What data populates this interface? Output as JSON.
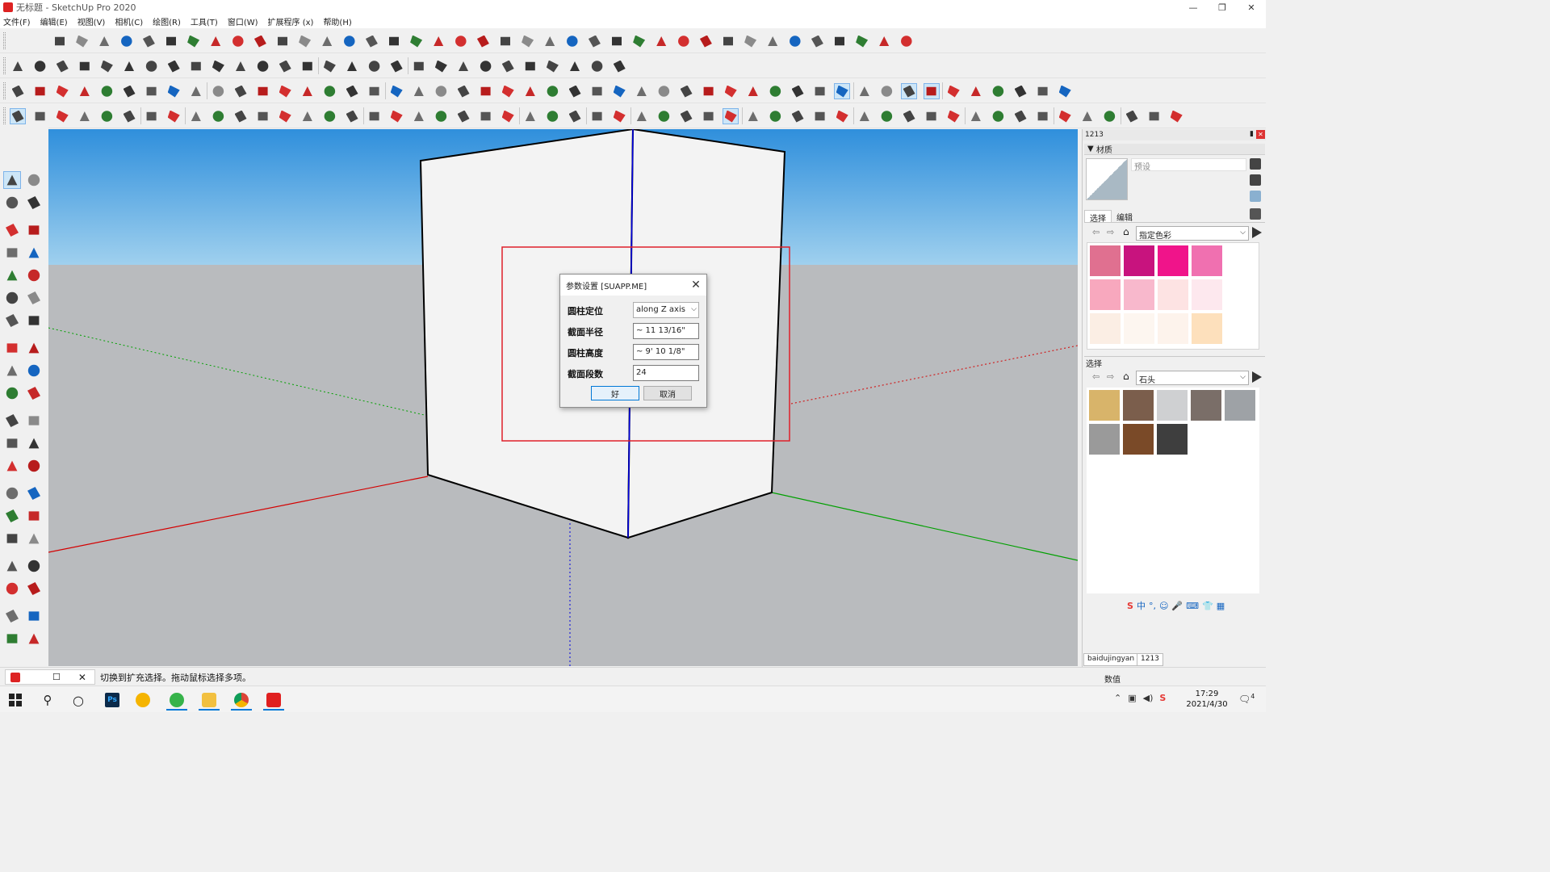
{
  "window": {
    "title": "无标题 - SketchUp Pro 2020",
    "controls": [
      "—",
      "❐",
      "✕"
    ]
  },
  "menu": [
    "文件(F)",
    "编辑(E)",
    "视图(V)",
    "相机(C)",
    "绘图(R)",
    "工具(T)",
    "窗口(W)",
    "扩展程序 (x)",
    "帮助(H)"
  ],
  "colors": {
    "sky_top": "#2f8fdc",
    "sky_bottom": "#9fd0ee",
    "ground": "#b9bbbe",
    "face": "#f3f3f3",
    "axis_red": "#d40000",
    "axis_green": "#00a000",
    "axis_blue": "#0000e0",
    "selection_rect": "#e0202a"
  },
  "dialog": {
    "title": "参数设置 [SUAPP.ME]",
    "fields": [
      {
        "label": "圆柱定位",
        "value": "along Z axis",
        "type": "select"
      },
      {
        "label": "截面半径",
        "value": "~ 11 13/16\"",
        "type": "input"
      },
      {
        "label": "圆柱高度",
        "value": "~ 9' 10 1/8\"",
        "type": "input"
      },
      {
        "label": "截面段数",
        "value": "24",
        "type": "input"
      }
    ],
    "ok_label": "好",
    "cancel_label": "取消"
  },
  "tray": {
    "title": "1213",
    "panel_title": "材质",
    "material_name_placeholder": "预设",
    "tabs": [
      "选择",
      "编辑"
    ],
    "collection1": "指定色彩",
    "section2_title": "选择",
    "collection2": "石头",
    "colors_grid": [
      "#e07090",
      "#c8137e",
      "#f0148a",
      "#f070b0",
      "#f8a8be",
      "#f8b8cc",
      "#fde3e3",
      "#fde8ee",
      "#fbeee4",
      "#fdf6f0",
      "#fdf3ec",
      "#fde0bc"
    ],
    "stone_grid": [
      "#d8b46a",
      "#7b5e4c",
      "#cfd0d2",
      "#7a6e68",
      "#9ea2a6",
      "#9a9a9a",
      "#7a4a28",
      "#3e3e3e"
    ]
  },
  "status": {
    "text": "切换到扩充选择。拖动鼠标选择多项。",
    "measure_label": "数值",
    "tabs": [
      "baidujingyan",
      "1213"
    ]
  },
  "taskbar": {
    "time": "17:29",
    "date": "2021/4/30",
    "ps_label": "Ps",
    "notif_count": "4",
    "ime_label": "中"
  }
}
